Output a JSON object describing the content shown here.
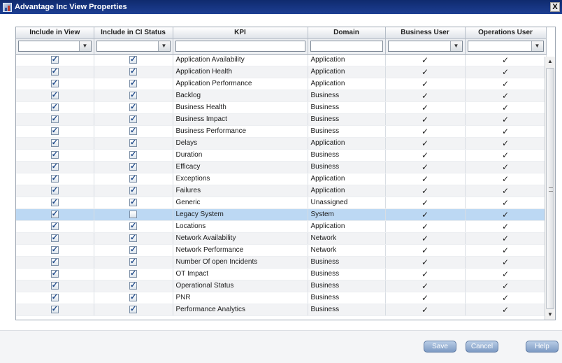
{
  "window": {
    "title": "Advantage Inc View Properties",
    "close_glyph": "X"
  },
  "columns": [
    "Include in View",
    "Include in CI Status",
    "KPI",
    "Domain",
    "Business User",
    "Operations User"
  ],
  "rows": [
    {
      "kpi": "Application Availability",
      "domain": "Application",
      "in_view": true,
      "in_ci": true,
      "selected": false
    },
    {
      "kpi": "Application Health",
      "domain": "Application",
      "in_view": true,
      "in_ci": true,
      "selected": false
    },
    {
      "kpi": "Application Performance",
      "domain": "Application",
      "in_view": true,
      "in_ci": true,
      "selected": false
    },
    {
      "kpi": "Backlog",
      "domain": "Business",
      "in_view": true,
      "in_ci": true,
      "selected": false
    },
    {
      "kpi": "Business Health",
      "domain": "Business",
      "in_view": true,
      "in_ci": true,
      "selected": false
    },
    {
      "kpi": "Business Impact",
      "domain": "Business",
      "in_view": true,
      "in_ci": true,
      "selected": false
    },
    {
      "kpi": "Business Performance",
      "domain": "Business",
      "in_view": true,
      "in_ci": true,
      "selected": false
    },
    {
      "kpi": "Delays",
      "domain": "Application",
      "in_view": true,
      "in_ci": true,
      "selected": false
    },
    {
      "kpi": "Duration",
      "domain": "Business",
      "in_view": true,
      "in_ci": true,
      "selected": false
    },
    {
      "kpi": "Efficacy",
      "domain": "Business",
      "in_view": true,
      "in_ci": true,
      "selected": false
    },
    {
      "kpi": "Exceptions",
      "domain": "Application",
      "in_view": true,
      "in_ci": true,
      "selected": false
    },
    {
      "kpi": "Failures",
      "domain": "Application",
      "in_view": true,
      "in_ci": true,
      "selected": false
    },
    {
      "kpi": "Generic",
      "domain": "Unassigned",
      "in_view": true,
      "in_ci": true,
      "selected": false
    },
    {
      "kpi": "Legacy System",
      "domain": "System",
      "in_view": true,
      "in_ci": false,
      "selected": true
    },
    {
      "kpi": "Locations",
      "domain": "Application",
      "in_view": true,
      "in_ci": true,
      "selected": false
    },
    {
      "kpi": "Network Availability",
      "domain": "Network",
      "in_view": true,
      "in_ci": true,
      "selected": false
    },
    {
      "kpi": "Network Performance",
      "domain": "Network",
      "in_view": true,
      "in_ci": true,
      "selected": false
    },
    {
      "kpi": "Number Of open Incidents",
      "domain": "Business",
      "in_view": true,
      "in_ci": true,
      "selected": false
    },
    {
      "kpi": "OT Impact",
      "domain": "Business",
      "in_view": true,
      "in_ci": true,
      "selected": false
    },
    {
      "kpi": "Operational Status",
      "domain": "Business",
      "in_view": true,
      "in_ci": true,
      "selected": false
    },
    {
      "kpi": "PNR",
      "domain": "Business",
      "in_view": true,
      "in_ci": true,
      "selected": false
    },
    {
      "kpi": "Performance Analytics",
      "domain": "Business",
      "in_view": true,
      "in_ci": true,
      "selected": false
    }
  ],
  "check_glyph": "✓",
  "buttons": {
    "save": "Save",
    "cancel": "Cancel",
    "help": "Help"
  },
  "colors": {
    "title_bar": "#1d3f93",
    "selected_row": "#bcd8f3",
    "button": "#7d9ac3"
  }
}
